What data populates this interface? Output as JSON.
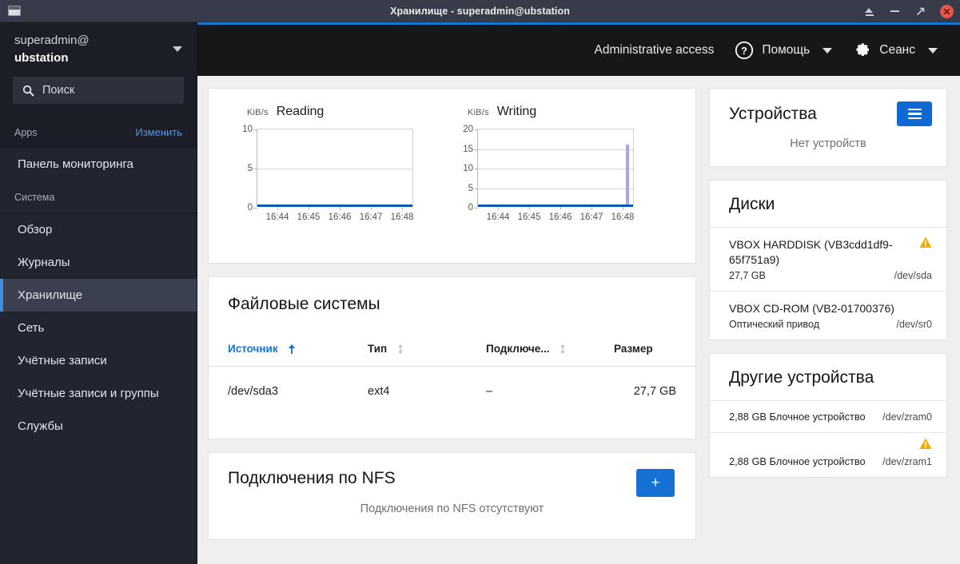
{
  "window": {
    "title": "Хранилище - superadmin@ubstation",
    "controls": [
      {
        "name": "eject",
        "label": ""
      },
      {
        "name": "minimize",
        "label": ""
      },
      {
        "name": "maximize",
        "label": ""
      },
      {
        "name": "close",
        "label": ""
      }
    ]
  },
  "sidebar": {
    "user_line1": "superadmin@",
    "user_line2": "ubstation",
    "search_placeholder": "Поиск",
    "apps_label": "Apps",
    "apps_edit": "Изменить",
    "dashboard": "Панель мониторинга",
    "system_label": "Система",
    "items": [
      {
        "label": "Обзор",
        "active": false
      },
      {
        "label": "Журналы",
        "active": false
      },
      {
        "label": "Хранилище",
        "active": true
      },
      {
        "label": "Сеть",
        "active": false
      },
      {
        "label": "Учётные записи",
        "active": false
      },
      {
        "label": "Учётные записи и группы",
        "active": false
      },
      {
        "label": "Службы",
        "active": false
      }
    ]
  },
  "header": {
    "admin_access": "Administrative access",
    "help": "Помощь",
    "session": "Сеанс"
  },
  "chart_data": [
    {
      "type": "line",
      "title": "Reading",
      "ylabel": "KiB/s",
      "x": [
        "16:44",
        "16:45",
        "16:46",
        "16:47",
        "16:48"
      ],
      "yticks": [
        0,
        5,
        10
      ],
      "ylim": [
        0,
        10
      ],
      "values": [
        0,
        0,
        0,
        0,
        0
      ],
      "spikes": [],
      "grid": true,
      "legend": "none"
    },
    {
      "type": "line",
      "title": "Writing",
      "ylabel": "KiB/s",
      "x": [
        "16:44",
        "16:45",
        "16:46",
        "16:47",
        "16:48"
      ],
      "yticks": [
        0,
        5,
        10,
        15,
        20
      ],
      "ylim": [
        0,
        20
      ],
      "values": [
        0,
        0,
        0,
        0,
        0
      ],
      "spikes": [
        {
          "x": "16:48",
          "value": 16
        }
      ],
      "grid": true,
      "legend": "none"
    }
  ],
  "filesystems": {
    "title": "Файловые системы",
    "columns": [
      {
        "label": "Источник",
        "sorted": true,
        "sort_dir": "asc"
      },
      {
        "label": "Тип",
        "sorted": false,
        "sort_dir": "none"
      },
      {
        "label": "Подключе...",
        "sorted": false,
        "sort_dir": "none"
      },
      {
        "label": "Размер",
        "sorted": false,
        "sort_dir": null
      }
    ],
    "rows": [
      {
        "source": "/dev/sda3",
        "type": "ext4",
        "mount": "–",
        "size": "27,7 GB"
      }
    ]
  },
  "nfs": {
    "title": "Подключения по NFS",
    "add_label": "+",
    "empty": "Подключения по NFS отсутствуют"
  },
  "devices": {
    "title": "Устройства",
    "menu_icon": "hamburger-icon",
    "empty": "Нет устройств"
  },
  "disks": {
    "title": "Диски",
    "rows": [
      {
        "name": "VBOX HARDDISK (VB3cdd1df9-65f751a9)",
        "size": "27,7 GB",
        "path": "/dev/sda",
        "warning": true
      },
      {
        "name": "VBOX CD-ROM (VB2-01700376)",
        "size": "Оптический привод",
        "path": "/dev/sr0",
        "warning": false
      }
    ]
  },
  "other_devices": {
    "title": "Другие устройства",
    "rows": [
      {
        "text": "2,88 GB Блочное устройство",
        "path": "/dev/zram0",
        "warning": false
      },
      {
        "text": "2,88 GB Блочное устройство",
        "path": "/dev/zram1",
        "warning": true
      }
    ]
  },
  "colors": {
    "accent_blue": "#1570d4",
    "titlebar": "#383c4a",
    "sidebar": "#212530",
    "header": "#151719",
    "warning": "#f0ab00",
    "close_red": "#e4564a"
  }
}
